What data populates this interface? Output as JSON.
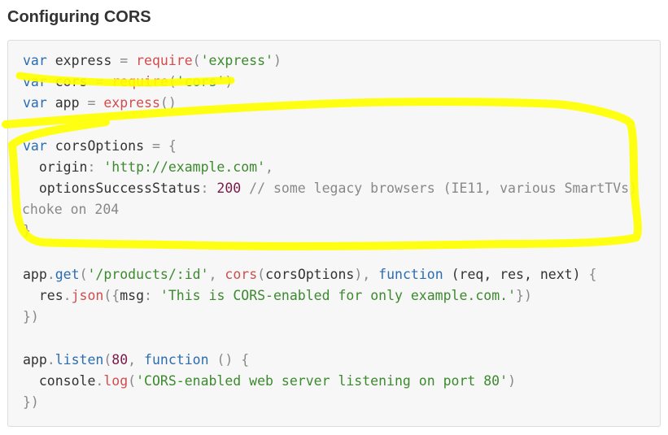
{
  "heading": "Configuring CORS",
  "annotation_color": "#ffff00",
  "code": {
    "l1": {
      "a": "var",
      "b": " express ",
      "c": "=",
      "d": " ",
      "e": "require",
      "f": "(",
      "g": "'express'",
      "h": ")"
    },
    "l2": {
      "a": "var",
      "b": " cors ",
      "c": "=",
      "d": " ",
      "e": "require",
      "f": "(",
      "g": "'cors'",
      "h": ")"
    },
    "l3": {
      "a": "var",
      "b": " app ",
      "c": "=",
      "d": " ",
      "e": "express",
      "f": "()"
    },
    "l5": {
      "a": "var",
      "b": " corsOptions ",
      "c": "=",
      "d": " {"
    },
    "l6": {
      "a": "  origin",
      "b": ":",
      "c": " ",
      "d": "'http://example.com'",
      "e": ","
    },
    "l7": {
      "a": "  optionsSuccessStatus",
      "b": ":",
      "c": " ",
      "d": "200",
      "e": " // some legacy browsers (IE11, various SmartTVs)"
    },
    "l8": {
      "a": "choke on 204"
    },
    "l9": {
      "a": "}"
    },
    "l11": {
      "a": "app",
      "b": ".",
      "c": "get",
      "d": "(",
      "e": "'/products/:id'",
      "f": ", ",
      "g": "cors",
      "h": "(",
      "i": "corsOptions",
      "j": "), ",
      "k": "function",
      "l": " (req, res, next) ",
      "m": "{"
    },
    "l12": {
      "a": "  res",
      "b": ".",
      "c": "json",
      "d": "({",
      "e": "msg",
      "f": ": ",
      "g": "'This is CORS-enabled for only example.com.'",
      "h": "})"
    },
    "l13": {
      "a": "})"
    },
    "l15": {
      "a": "app",
      "b": ".",
      "c": "listen",
      "d": "(",
      "e": "80",
      "f": ", ",
      "g": "function",
      "h": " () ",
      "i": "{"
    },
    "l16": {
      "a": "  console",
      "b": ".",
      "c": "log",
      "d": "(",
      "e": "'CORS-enabled web server listening on port 80'",
      "f": ")"
    },
    "l17": {
      "a": "})"
    }
  }
}
